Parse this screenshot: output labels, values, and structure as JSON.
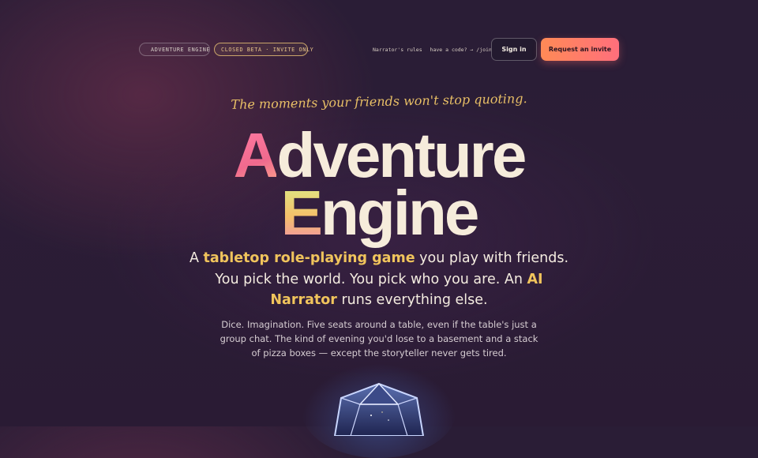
{
  "nav": {
    "brand_label": "ADVENTURE ENGINE",
    "beta_badge": "CLOSED BETA · INVITE ONLY",
    "narrator_rules_link": "Narrator's rules",
    "code_hint": "have a code? → /join",
    "signin_label": "Sign in",
    "invite_label": "Request an invite"
  },
  "hero": {
    "tagline": "The moments your friends won't stop quoting.",
    "title_line1_cap": "A",
    "title_line1_rest": "dventure",
    "title_line2_cap": "E",
    "title_line2_rest": "ngine",
    "lead_part1": "A ",
    "lead_highlight1": "tabletop role-playing game",
    "lead_part2": " you play with friends. You pick the world. You pick who you are. An ",
    "lead_highlight2": "AI Narrator",
    "lead_part3": " runs everything else.",
    "subtext": "Dice. Imagination. Five seats around a table, even if the table's just a group chat. The kind of evening you'd lose to a basement and a stack of pizza boxes — except the storyteller never gets tired."
  },
  "colors": {
    "accent_gold": "#f0c45c",
    "accent_pink": "#ff6f7c",
    "accent_orange": "#ff8a56",
    "background": "#2a1d36"
  },
  "icons": {
    "brand_dot": "dot-icon",
    "hero_art": "d20-dice-icon"
  }
}
